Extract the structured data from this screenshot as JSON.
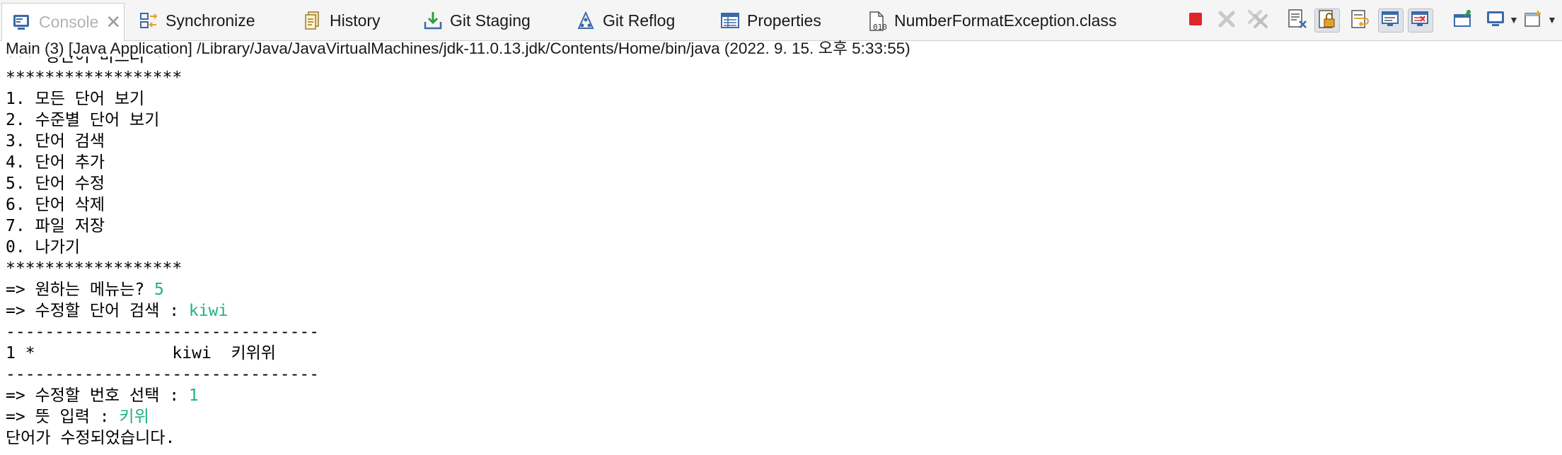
{
  "tabs": [
    {
      "label": "Console",
      "icon": "console-icon",
      "active": true
    },
    {
      "label": "Synchronize",
      "icon": "synchronize-icon"
    },
    {
      "label": "History",
      "icon": "history-icon"
    },
    {
      "label": "Git Staging",
      "icon": "git-staging-icon"
    },
    {
      "label": "Git Reflog",
      "icon": "git-reflog-icon"
    },
    {
      "label": "Properties",
      "icon": "properties-icon"
    },
    {
      "label": "NumberFormatException.class",
      "icon": "class-file-icon"
    }
  ],
  "toolbar": {
    "icons": [
      "terminate-icon",
      "remove-launch-icon",
      "remove-all-terminated-icon",
      "clear-console-icon",
      "scroll-lock-icon",
      "word-wrap-icon",
      "show-console-on-stdout-icon",
      "show-console-on-stderr-icon",
      "pin-console-icon",
      "display-selected-console-icon",
      "open-console-icon"
    ]
  },
  "launch_info": "Main (3) [Java Application] /Library/Java/JavaVirtualMachines/jdk-11.0.13.jdk/Contents/Home/bin/java  (2022. 9. 15. 오후 5:33:55)",
  "console": {
    "lines": [
      {
        "text": "*** 영단어 마스터 ***"
      },
      {
        "text": "******************"
      },
      {
        "text": "1. 모든 단어 보기"
      },
      {
        "text": "2. 수준별 단어 보기"
      },
      {
        "text": "3. 단어 검색"
      },
      {
        "text": "4. 단어 추가"
      },
      {
        "text": "5. 단어 수정"
      },
      {
        "text": "6. 단어 삭제"
      },
      {
        "text": "7. 파일 저장"
      },
      {
        "text": "0. 나가기"
      },
      {
        "text": "******************"
      },
      {
        "text": "=> 원하는 메뉴는? ",
        "input": "5"
      },
      {
        "text": "=> 수정할 단어 검색 : ",
        "input": "kiwi"
      },
      {
        "text": "--------------------------------"
      },
      {
        "text": "1 *              kiwi  키위위"
      },
      {
        "text": "--------------------------------"
      },
      {
        "text": "=> 수정할 번호 선택 : ",
        "input": "1"
      },
      {
        "text": "=> 뜻 입력 : ",
        "input": "키위"
      },
      {
        "text": "단어가 수정되었습니다.",
        "cursor": true
      }
    ]
  },
  "colors": {
    "user_input": "#1fb37a",
    "terminate": "#e0242a"
  }
}
